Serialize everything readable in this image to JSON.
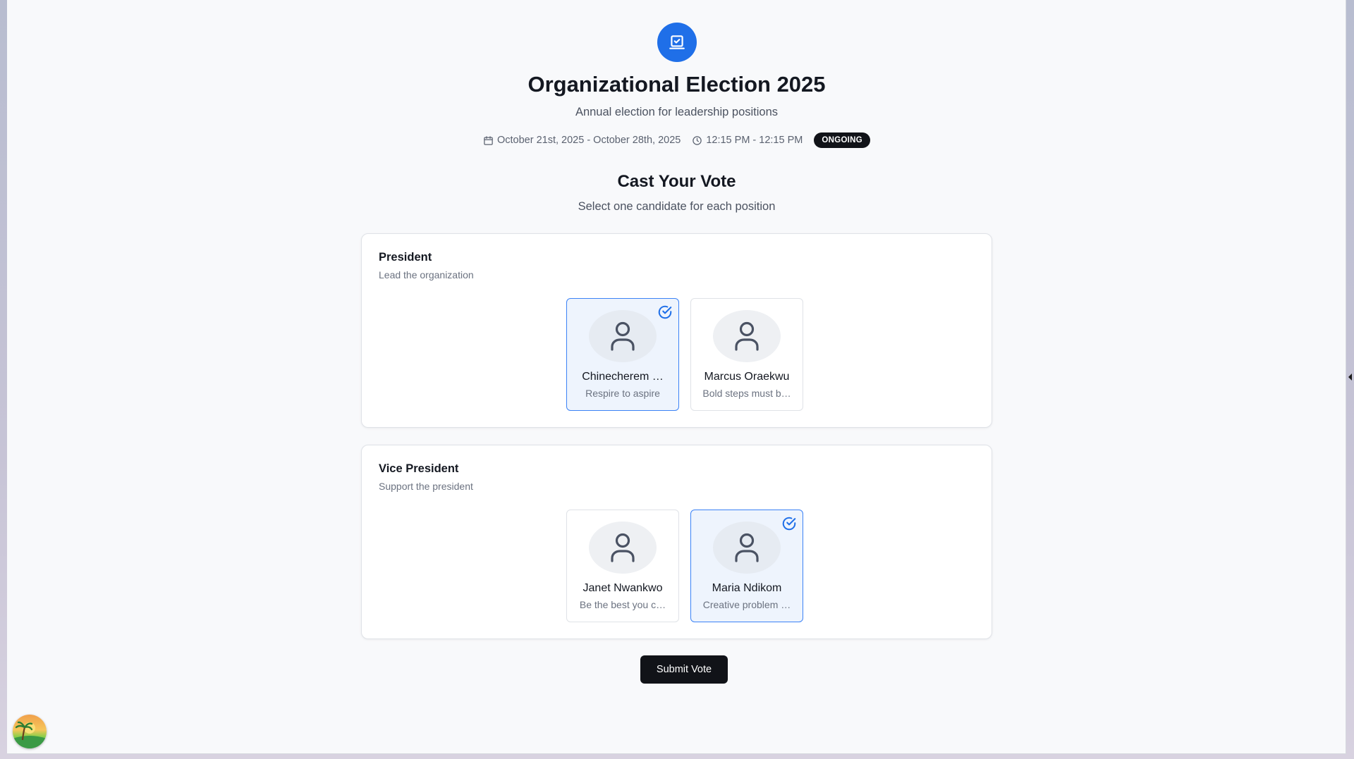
{
  "app": {
    "title": "Organizational Election 2025",
    "subtitle": "Annual election for leadership positions",
    "hero_icon": "vote-box-icon",
    "accent_color": "#1f6fe8"
  },
  "meta": {
    "date_range": "October 21st, 2025 - October 28th, 2025",
    "time_range": "12:15 PM - 12:15 PM",
    "status": "ONGOING"
  },
  "ballot": {
    "title": "Cast Your Vote",
    "subtitle": "Select one candidate for each position"
  },
  "positions": [
    {
      "title": "President",
      "description": "Lead the organization",
      "candidates": [
        {
          "name": "Chinecherem Okafor",
          "display_name": "Chinecherem …",
          "motto": "Respire to aspire",
          "selected": true
        },
        {
          "name": "Marcus Oraekwu",
          "display_name": "Marcus Oraekwu",
          "motto": "Bold steps must b…",
          "selected": false
        }
      ]
    },
    {
      "title": "Vice President",
      "description": "Support the president",
      "candidates": [
        {
          "name": "Janet Nwankwo",
          "display_name": "Janet Nwankwo",
          "motto": "Be the best you c…",
          "selected": false
        },
        {
          "name": "Maria Ndikom",
          "display_name": "Maria Ndikom",
          "motto": "Creative problem …",
          "selected": true
        }
      ]
    }
  ],
  "actions": {
    "submit_label": "Submit Vote"
  }
}
